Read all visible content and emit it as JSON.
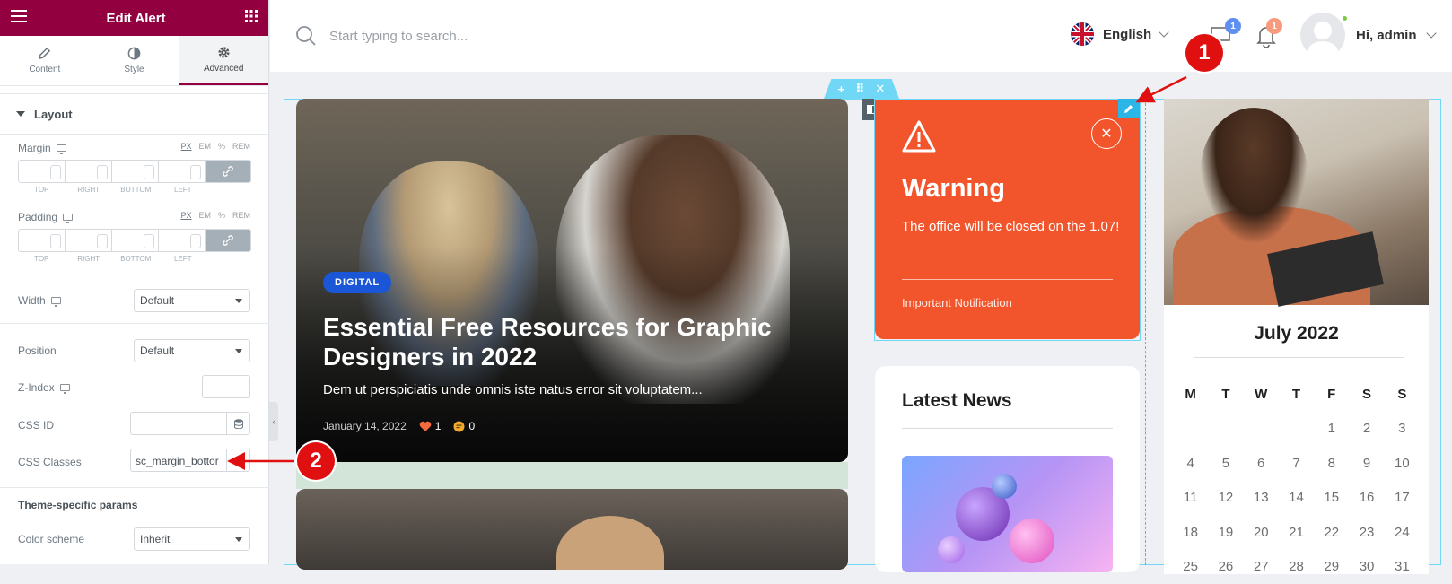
{
  "editor": {
    "title": "Edit Alert",
    "tabs": [
      {
        "label": "Content",
        "icon": "pencil-icon"
      },
      {
        "label": "Style",
        "icon": "half-circle-icon"
      },
      {
        "label": "Advanced",
        "icon": "gear-icon",
        "active": true
      }
    ],
    "section_title": "Layout",
    "units": [
      "PX",
      "EM",
      "%",
      "REM"
    ],
    "margin": {
      "label": "Margin",
      "sides": [
        "TOP",
        "RIGHT",
        "BOTTOM",
        "LEFT"
      ]
    },
    "padding": {
      "label": "Padding",
      "sides": [
        "TOP",
        "RIGHT",
        "BOTTOM",
        "LEFT"
      ]
    },
    "width": {
      "label": "Width",
      "value": "Default"
    },
    "position": {
      "label": "Position",
      "value": "Default"
    },
    "zindex": {
      "label": "Z-Index",
      "value": ""
    },
    "css_id": {
      "label": "CSS ID",
      "value": ""
    },
    "css_classes": {
      "label": "CSS Classes",
      "value": "sc_margin_bottor"
    },
    "theme_section": "Theme-specific params",
    "color_scheme": {
      "label": "Color scheme",
      "value": "Inherit"
    }
  },
  "topbar": {
    "search_placeholder": "Start typing to search...",
    "language": "English",
    "messages_count": "1",
    "notifications_count": "1",
    "greeting": "Hi,",
    "username": "admin"
  },
  "post": {
    "category": "DIGITAL",
    "title": "Essential Free Resources for Graphic Designers in 2022",
    "excerpt": "Dem ut perspiciatis unde omnis iste natus error sit voluptatem...",
    "date": "January 14, 2022",
    "likes": "1",
    "comments": "0"
  },
  "alert": {
    "title": "Warning",
    "text": "The office will be closed on the 1.07!",
    "footer": "Important Notification",
    "bg_color": "#f2552c"
  },
  "news": {
    "title": "Latest News"
  },
  "calendar": {
    "month": "July 2022",
    "weekdays": [
      "M",
      "T",
      "W",
      "T",
      "F",
      "S",
      "S"
    ],
    "weeks": [
      [
        "",
        "",
        "",
        "",
        "1",
        "2",
        "3"
      ],
      [
        "4",
        "5",
        "6",
        "7",
        "8",
        "9",
        "10"
      ],
      [
        "11",
        "12",
        "13",
        "14",
        "15",
        "16",
        "17"
      ],
      [
        "18",
        "19",
        "20",
        "21",
        "22",
        "23",
        "24"
      ],
      [
        "25",
        "26",
        "27",
        "28",
        "29",
        "30",
        "31"
      ]
    ]
  },
  "annotations": [
    {
      "label": "1"
    },
    {
      "label": "2"
    }
  ],
  "colors": {
    "brand": "#93003f",
    "accent": "#71d7f7",
    "marker": "#e11010"
  }
}
